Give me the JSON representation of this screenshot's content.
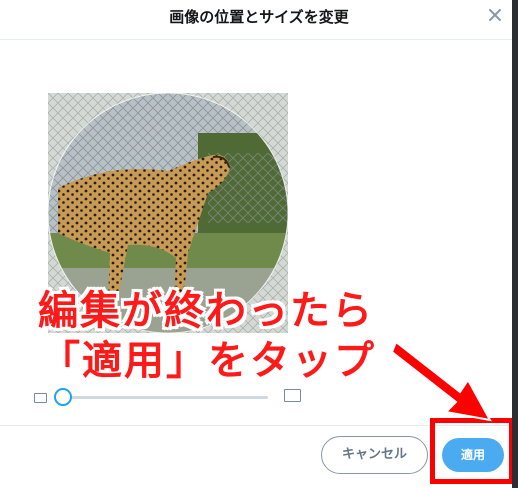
{
  "dialog": {
    "title": "画像の位置とサイズを変更",
    "close_icon": "close-icon"
  },
  "zoom": {
    "min_icon": "image-small-icon",
    "max_icon": "image-large-icon",
    "level": 0
  },
  "footer": {
    "cancel_label": "キャンセル",
    "apply_label": "適用"
  },
  "annotation": {
    "line1": "編集が終わったら",
    "line2": "「適用」をタップ",
    "highlight_color": "#ff0000",
    "arrow_icon": "red-arrow-icon"
  },
  "colors": {
    "accent": "#1da1f2",
    "apply_button": "#4aabf0"
  }
}
